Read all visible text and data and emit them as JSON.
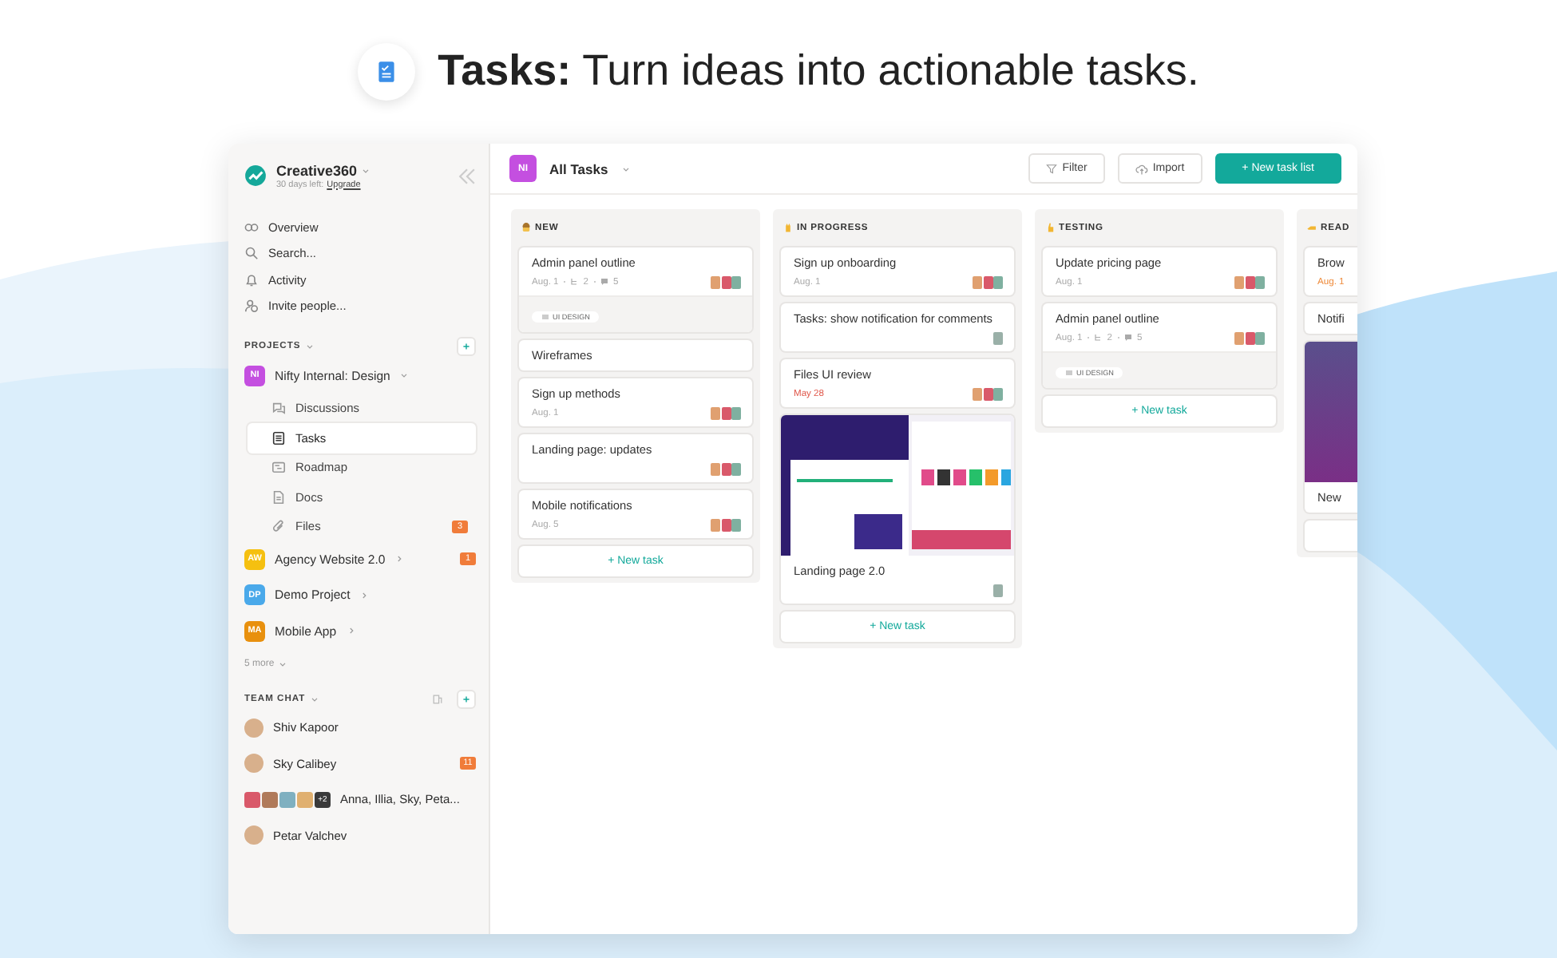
{
  "headline": "**Tasks:** Turn ideas into actionable tasks.",
  "workspace": {
    "name": "Creative360",
    "trial": "30 days left:",
    "upgrade_link": "Upgrade"
  },
  "nav": [
    {
      "label": "Overview"
    },
    {
      "label": "Search..."
    },
    {
      "label": "Activity"
    },
    {
      "label": "Invite people..."
    }
  ],
  "projects": {
    "heading": "PROJECTS",
    "more": "5 more",
    "items": [
      {
        "initials": "NI",
        "name": "Nifty Internal: Design",
        "color": "#c44fe0",
        "expanded": true,
        "children": [
          {
            "label": "Discussions",
            "selected": false
          },
          {
            "label": "Tasks",
            "selected": true
          },
          {
            "label": "Roadmap",
            "selected": false
          },
          {
            "label": "Docs",
            "selected": false
          },
          {
            "label": "Files",
            "selected": false,
            "badge": "3"
          }
        ]
      },
      {
        "initials": "AW",
        "name": "Agency Website 2.0",
        "color": "#f5c010",
        "expanded": false,
        "badge": "1"
      },
      {
        "initials": "DP",
        "name": "Demo Project",
        "color": "#4aa9ea",
        "expanded": false
      },
      {
        "initials": "MA",
        "name": "Mobile App",
        "color": "#e8900e",
        "expanded": false
      }
    ]
  },
  "team_chat": {
    "heading": "TEAM CHAT",
    "items": [
      {
        "kind": "direct",
        "name": "Shiv Kapoor"
      },
      {
        "kind": "direct",
        "name": "Sky Calibey",
        "badge": "11"
      },
      {
        "kind": "group",
        "name": "Anna, Illia, Sky, Peta...",
        "extra": "+2"
      },
      {
        "kind": "direct",
        "name": "Petar Valchev"
      }
    ]
  },
  "toolbar": {
    "initials": "NI",
    "color": "#c44fe0",
    "title": "All Tasks",
    "filter": "Filter",
    "import": "Import",
    "new_list": "+ New task list"
  },
  "columns": [
    {
      "title": "NEW",
      "new_task": "+ New task",
      "cards": [
        {
          "kind": "task",
          "title": "Admin panel outline",
          "date": "Aug. 1",
          "overdue": false,
          "due_soon": false,
          "subtasks": "2",
          "comments": "5",
          "tag": "UI DESIGN",
          "team_assigned": true
        },
        {
          "kind": "task",
          "title": "Wireframes"
        },
        {
          "kind": "task",
          "title": "Sign up methods",
          "date": "Aug. 1",
          "overdue": false,
          "due_soon": false,
          "team_assigned": true
        },
        {
          "kind": "task",
          "title": "Landing page: updates",
          "team_assigned": true
        },
        {
          "kind": "task",
          "title": "Mobile notifications",
          "date": "Aug. 5",
          "overdue": false,
          "due_soon": false,
          "team_assigned": true
        }
      ]
    },
    {
      "title": "IN PROGRESS",
      "new_task": "+ New task",
      "cards": [
        {
          "kind": "task",
          "title": "Sign up onboarding",
          "date": "Aug. 1",
          "overdue": false,
          "due_soon": false,
          "team_assigned": true
        },
        {
          "kind": "task",
          "title": "Tasks: show notification for comments",
          "single_assigned": true
        },
        {
          "kind": "task",
          "title": "Files UI review",
          "date": "May 28",
          "overdue": true,
          "due_soon": false,
          "team_assigned": true
        },
        {
          "kind": "image",
          "title": "Landing page 2.0",
          "single_assigned": true
        }
      ]
    },
    {
      "title": "TESTING",
      "new_task": "+ New task",
      "cards": [
        {
          "kind": "task",
          "title": "Update pricing page",
          "date": "Aug. 1",
          "overdue": false,
          "due_soon": false,
          "team_assigned": true
        },
        {
          "kind": "task",
          "title": "Admin panel outline",
          "date": "Aug. 1",
          "overdue": false,
          "due_soon": false,
          "subtasks": "2",
          "comments": "5",
          "tag": "UI DESIGN",
          "team_assigned": true
        }
      ]
    },
    {
      "title": "READ",
      "cards": [
        {
          "kind": "task",
          "title": "Brow",
          "date": "Aug. 1",
          "overdue": false,
          "due_soon": true
        },
        {
          "kind": "task",
          "title": "Notifi"
        },
        {
          "kind": "gradient",
          "title": "New"
        }
      ]
    }
  ]
}
